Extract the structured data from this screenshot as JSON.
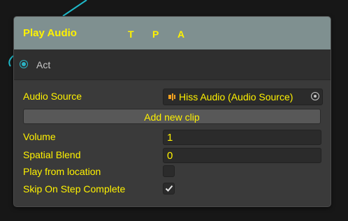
{
  "node": {
    "title": "Play Audio",
    "header_tags": [
      "T",
      "P",
      "A"
    ],
    "header_color": "#7f9090",
    "accent_color": "#fff200",
    "port": {
      "label": "Act",
      "dot_color": "#2bb3c4"
    }
  },
  "fields": {
    "audio_source": {
      "label": "Audio Source",
      "value": "Hiss Audio (Audio Source)",
      "icon": "audio-source-icon"
    },
    "add_clip_label": "Add new clip",
    "volume": {
      "label": "Volume",
      "value": "1"
    },
    "spatial_blend": {
      "label": "Spatial Blend",
      "value": "0"
    },
    "play_from_location": {
      "label": "Play from location",
      "checked": false
    },
    "skip_on_step_complete": {
      "label": "Skip On Step Complete",
      "checked": true
    }
  }
}
